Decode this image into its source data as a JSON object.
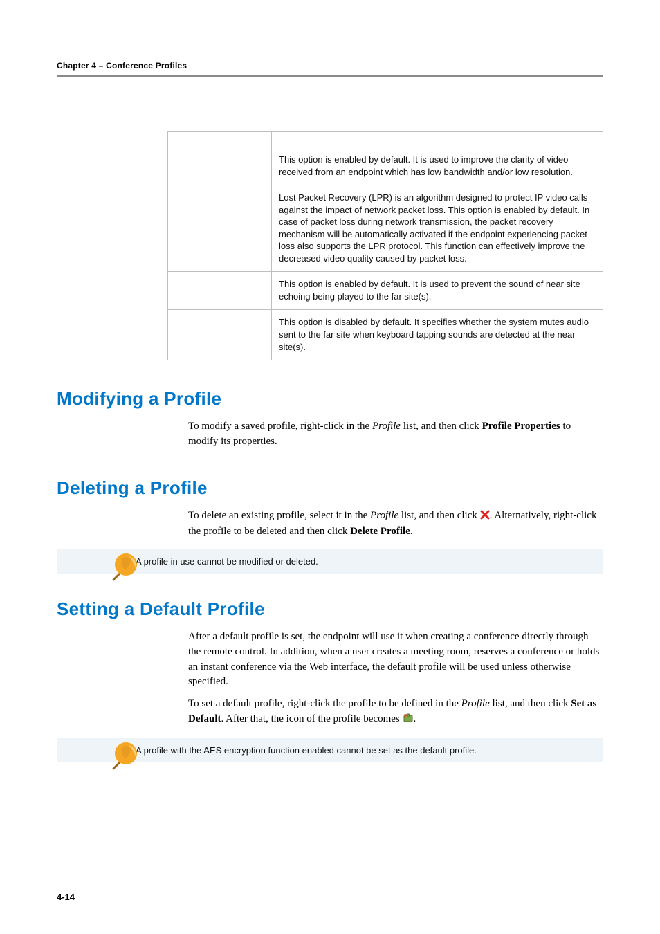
{
  "runhead": "Chapter 4 – Conference Profiles",
  "table": {
    "rows": [
      {
        "label": "",
        "desc": "This option is enabled by default. It is used to improve the clarity of video received from an endpoint which has low bandwidth and/or low resolution."
      },
      {
        "label": "",
        "desc": "Lost Packet Recovery (LPR) is an algorithm designed to protect IP video calls against the impact of network packet loss. This option is enabled by default. In case of packet loss during network transmission, the packet recovery mechanism will be automatically activated if the endpoint experiencing packet loss also supports the LPR protocol. This function can effectively improve the decreased video quality caused by packet loss."
      },
      {
        "label": "",
        "desc": "This option is enabled by default. It is used to prevent the sound of near site echoing being played to the far site(s)."
      },
      {
        "label": "",
        "desc": "This option is disabled by default. It specifies whether the system mutes audio sent to the far site when keyboard tapping sounds are detected at the near site(s)."
      }
    ]
  },
  "sections": {
    "modify": {
      "heading": "Modifying a Profile",
      "p1_a": "To modify a saved profile, right-click in the ",
      "p1_i": "Profile",
      "p1_b": " list, and then click ",
      "p1_bold": "Profile Properties",
      "p1_c": " to modify its properties."
    },
    "delete": {
      "heading": "Deleting a Profile",
      "p1_a": "To delete an existing profile, select it in the ",
      "p1_i": "Profile",
      "p1_b": " list, and then click ",
      "p1_c": ". Alternatively, right-click the profile to be deleted and then click ",
      "p1_bold": "Delete Profile",
      "p1_d": ".",
      "note": "A profile in use cannot be modified or deleted."
    },
    "default": {
      "heading": "Setting a Default Profile",
      "p1": "After a default profile is set, the endpoint will use it when creating a conference directly through the remote control. In addition, when a user creates a meeting room, reserves a conference or holds an instant conference via the Web interface, the default profile will be used unless otherwise specified.",
      "p2_a": "To set a default profile, right-click the profile to be defined in the ",
      "p2_i": "Profile",
      "p2_b": " list, and then click ",
      "p2_bold": "Set as Default",
      "p2_c": ". After that, the icon of the profile becomes ",
      "p2_d": ".",
      "note": "A profile with the AES encryption function enabled cannot be set as the default profile."
    }
  },
  "page_number": "4-14"
}
